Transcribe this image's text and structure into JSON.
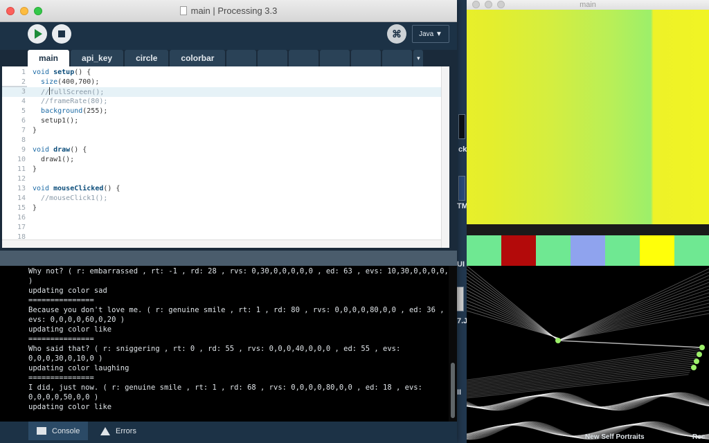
{
  "processing_window": {
    "title": "main | Processing 3.3",
    "mode": "Java ▼",
    "tabs": [
      "main",
      "api_key",
      "circle",
      "colorbar"
    ],
    "tab_menu": "▾",
    "code_lines": [
      {
        "n": "1",
        "text": "void setup() {"
      },
      {
        "n": "2",
        "text": "  size(400,700);"
      },
      {
        "n": "3",
        "text": "  //fullScreen();"
      },
      {
        "n": "4",
        "text": "  //frameRate(80);"
      },
      {
        "n": "5",
        "text": "  background(255);"
      },
      {
        "n": "6",
        "text": "  setup1();"
      },
      {
        "n": "7",
        "text": "}"
      },
      {
        "n": "8",
        "text": ""
      },
      {
        "n": "9",
        "text": "void draw() {"
      },
      {
        "n": "10",
        "text": "  draw1();"
      },
      {
        "n": "11",
        "text": "}"
      },
      {
        "n": "12",
        "text": ""
      },
      {
        "n": "13",
        "text": "void mouseClicked() {"
      },
      {
        "n": "14",
        "text": "  //mouseClick1();"
      },
      {
        "n": "15",
        "text": "}"
      },
      {
        "n": "16",
        "text": ""
      },
      {
        "n": "17",
        "text": ""
      },
      {
        "n": "18",
        "text": ""
      }
    ],
    "console_lines": [
      "Why not? ( r: embarrassed , rt: -1 , rd: 28 , rvs: 0,30,0,0,0,0,0 , ed: 63 , evs: 10,30,0,0,0,0,0",
      ")",
      "updating color sad",
      "===============",
      "Because you don't love me. ( r: genuine smile , rt: 1 , rd: 80 , rvs: 0,0,0,0,80,0,0 , ed: 36 ,",
      "evs: 0,0,0,0,60,0,20 )",
      "updating color like",
      "===============",
      "Who said that? ( r: sniggering , rt: 0 , rd: 55 , rvs: 0,0,0,40,0,0,0 , ed: 55 , evs:",
      "0,0,0,30,0,10,0 )",
      "updating color laughing",
      "===============",
      "I did, just now. ( r: genuine smile , rt: 1 , rd: 68 , rvs: 0,0,0,0,80,0,0 , ed: 18 , evs:",
      "0,0,0,0,50,0,0 )",
      "updating color like"
    ],
    "footer": {
      "console": "Console",
      "errors": "Errors"
    }
  },
  "sketch_window": {
    "title": "main",
    "swatches": [
      "#6fe892",
      "#b30a0a",
      "#6fe892",
      "#8fa3ee",
      "#6fe892",
      "#ffff0a",
      "#6fe892"
    ]
  },
  "desktop": {
    "fragments": [
      "ck",
      "TM",
      "UI",
      "7.J",
      "II",
      "New Self Portraits",
      "Rec"
    ]
  },
  "colors": {
    "editor_bg": "#ffffff",
    "toolbar_bg": "#1c3246",
    "run_green": "#1c8c39"
  }
}
